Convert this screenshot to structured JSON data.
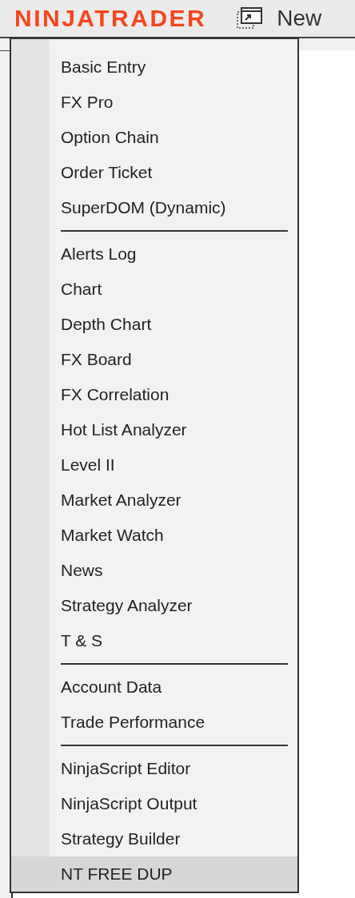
{
  "header": {
    "logo": "NINJATRADER",
    "menu_label": "New"
  },
  "menu_groups": [
    {
      "items": [
        {
          "label": "Basic Entry",
          "selected": false
        },
        {
          "label": "FX Pro",
          "selected": false
        },
        {
          "label": "Option Chain",
          "selected": false
        },
        {
          "label": "Order Ticket",
          "selected": false
        },
        {
          "label": "SuperDOM (Dynamic)",
          "selected": false
        }
      ]
    },
    {
      "items": [
        {
          "label": "Alerts Log",
          "selected": false
        },
        {
          "label": "Chart",
          "selected": false
        },
        {
          "label": "Depth Chart",
          "selected": false
        },
        {
          "label": "FX Board",
          "selected": false
        },
        {
          "label": "FX Correlation",
          "selected": false
        },
        {
          "label": "Hot List Analyzer",
          "selected": false
        },
        {
          "label": "Level II",
          "selected": false
        },
        {
          "label": "Market Analyzer",
          "selected": false
        },
        {
          "label": "Market Watch",
          "selected": false
        },
        {
          "label": "News",
          "selected": false
        },
        {
          "label": "Strategy Analyzer",
          "selected": false
        },
        {
          "label": "T & S",
          "selected": false
        }
      ]
    },
    {
      "items": [
        {
          "label": "Account Data",
          "selected": false
        },
        {
          "label": "Trade Performance",
          "selected": false
        }
      ]
    },
    {
      "items": [
        {
          "label": "NinjaScript Editor",
          "selected": false
        },
        {
          "label": "NinjaScript Output",
          "selected": false
        },
        {
          "label": "Strategy Builder",
          "selected": false
        },
        {
          "label": "NT FREE DUP",
          "selected": true
        }
      ]
    }
  ]
}
